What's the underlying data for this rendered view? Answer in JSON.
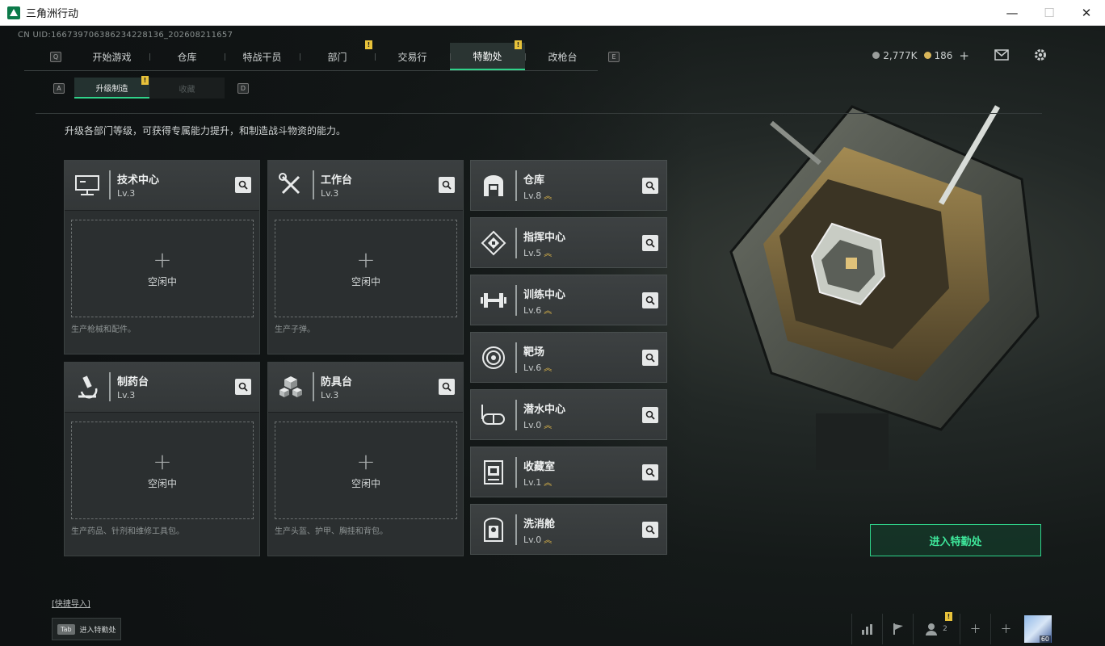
{
  "window": {
    "title": "三角洲行动",
    "controls": {
      "minimize": "—",
      "maximize": "☐",
      "close": "✕"
    }
  },
  "uid": "CN UID:16673970638623422813​6_202608211657",
  "nav": {
    "key_left": "Q",
    "key_right": "E",
    "tabs": [
      "开始游戏",
      "仓库",
      "特战干员",
      "部门",
      "交易行",
      "特勤处",
      "改枪台"
    ],
    "active": "特勤处",
    "badge": "!"
  },
  "currency": {
    "coins": "2,777K",
    "tickets": "186",
    "add": "+"
  },
  "subnav": {
    "key_left": "A",
    "key_right": "D",
    "tabs": [
      "升级制造",
      "收藏"
    ],
    "active": "升级制造"
  },
  "description": "升级各部门等级，可获得专属能力提升，和制造战斗物资的能力。",
  "workstations": [
    {
      "name": "技术中心",
      "level": "Lv.3",
      "status": "空闲中",
      "plus": "+",
      "desc": "生产枪械和配件。",
      "icon": "computer-icon"
    },
    {
      "name": "工作台",
      "level": "Lv.3",
      "status": "空闲中",
      "plus": "+",
      "desc": "生产子弹。",
      "icon": "tools-icon"
    },
    {
      "name": "制药台",
      "level": "Lv.3",
      "status": "空闲中",
      "plus": "+",
      "desc": "生产药品、针剂和维修工具包。",
      "icon": "microscope-icon"
    },
    {
      "name": "防具台",
      "level": "Lv.3",
      "status": "空闲中",
      "plus": "+",
      "desc": "生产头盔、护甲、胸挂和背包。",
      "icon": "cubes-icon"
    }
  ],
  "facilities": [
    {
      "name": "仓库",
      "level": "Lv.8",
      "icon": "warehouse-icon"
    },
    {
      "name": "指挥中心",
      "level": "Lv.5",
      "icon": "command-icon"
    },
    {
      "name": "训练中心",
      "level": "Lv.6",
      "icon": "dumbbell-icon"
    },
    {
      "name": "靶场",
      "level": "Lv.6",
      "icon": "target-icon"
    },
    {
      "name": "潜水中心",
      "level": "Lv.0",
      "icon": "diving-mask-icon"
    },
    {
      "name": "收藏室",
      "level": "Lv.1",
      "icon": "collection-icon"
    },
    {
      "name": "洗消舱",
      "level": "Lv.0",
      "icon": "decon-icon"
    }
  ],
  "enter_button": "进入特勤处",
  "quick_import": "[快捷导入]",
  "tab_hint": {
    "key": "Tab",
    "label": "进入特勤处"
  },
  "bottom": {
    "friends_count": "2",
    "avatar_level": "60"
  },
  "colors": {
    "accent": "#2fd38a",
    "badge": "#e8c23a",
    "upgrade_chevron": "#e0b84a"
  }
}
